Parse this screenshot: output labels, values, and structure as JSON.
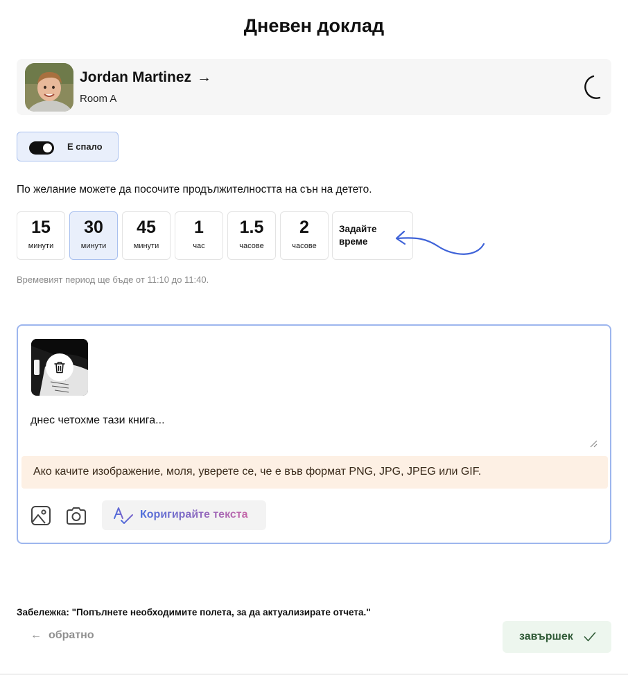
{
  "page": {
    "title": "Дневен доклад"
  },
  "child": {
    "name": "Jordan Martinez",
    "arrow": "→",
    "room": "Room A",
    "avatar_icon": "child-photo",
    "status_icon": "moon-icon"
  },
  "sleep_toggle": {
    "label": "Е спало",
    "on": true
  },
  "duration": {
    "hint": "По желание можете да посочите продължителността на сън на детето.",
    "options": [
      {
        "value": "15",
        "unit": "минути",
        "selected": false
      },
      {
        "value": "30",
        "unit": "минути",
        "selected": true
      },
      {
        "value": "45",
        "unit": "минути",
        "selected": false
      },
      {
        "value": "1",
        "unit": "час",
        "selected": false
      },
      {
        "value": "1.5",
        "unit": "часове",
        "selected": false
      },
      {
        "value": "2",
        "unit": "часове",
        "selected": false
      }
    ],
    "custom_label": "Задайте време",
    "period_text": "Времевият период ще бъде от 11:10 до 11:40."
  },
  "editor": {
    "text": "днес четохме тази книга...",
    "warning": "Ако качите изображение, моля, уверете се, че е във формат PNG, JPG, JPEG или GIF.",
    "correct_label": "Коригирайте текста",
    "icons": [
      "image-icon",
      "camera-icon",
      "trash-icon",
      "spell-check-icon"
    ]
  },
  "footer": {
    "note": "Забележка: \"Попълнете необходимите полета, за да актуализирате отчета.\"",
    "back_arrow": "←",
    "back_label": "обратно",
    "finish_label": "завършек"
  },
  "colors": {
    "accent": "#4d6fdc",
    "selected_bg": "#e9effb",
    "finish_bg": "#edf6ee",
    "warning_bg": "#fdf0e4"
  }
}
